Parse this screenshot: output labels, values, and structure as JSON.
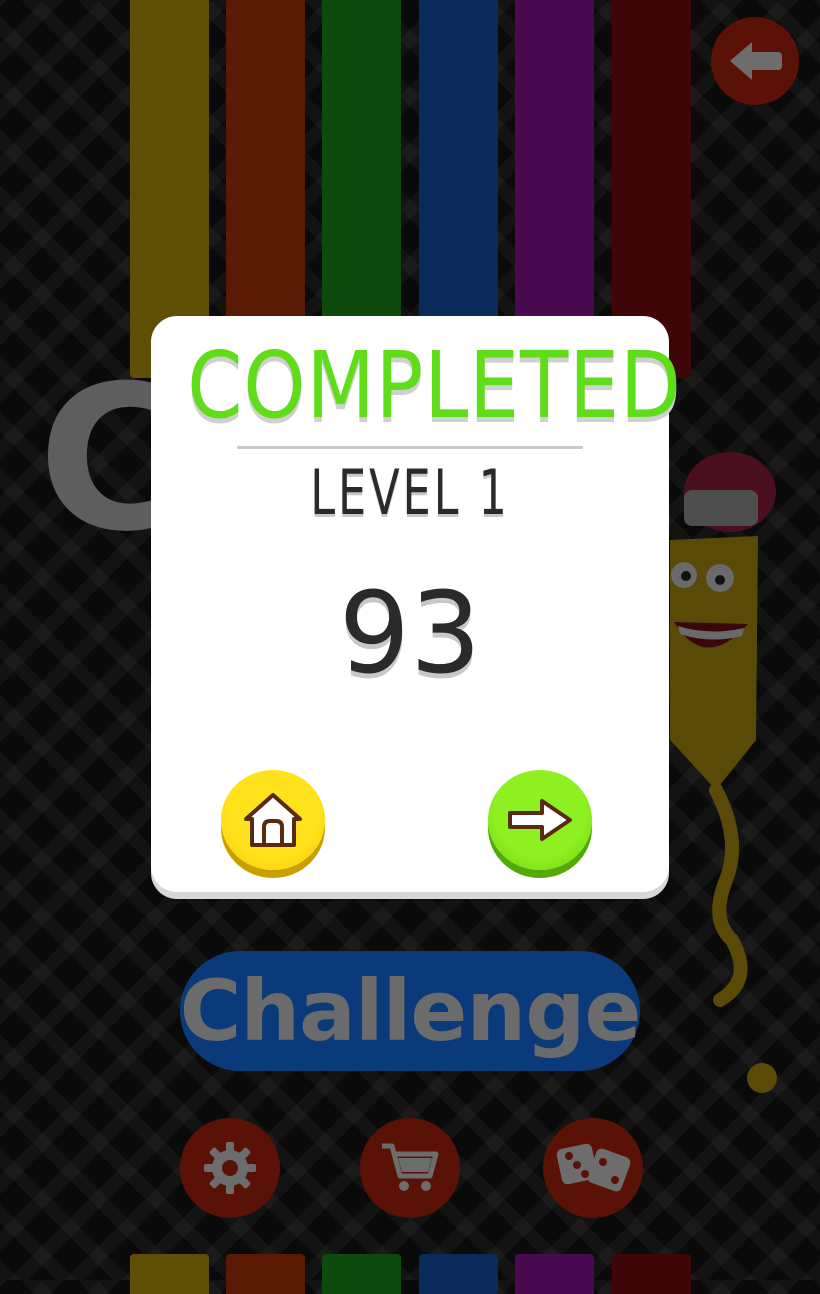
{
  "colors": {
    "stripes": [
      "#5e4e06",
      "#5a1a06",
      "#0e4a0e",
      "#0a2a5c",
      "#4a0a52",
      "#3e0606"
    ],
    "back_button": "#5a1206",
    "round_button": "#5a1206",
    "challenge_button": "#0b3a7a",
    "challenge_text": "#6b6b6b",
    "big_letter": "#5e5e5e",
    "completed_title": "#5fdd18",
    "level_text": "#2a2a2a",
    "score_text": "#2a2a2a",
    "divider": "#c9c9c9"
  },
  "background": {
    "big_letter": "C",
    "challenge_label": "Challenge",
    "icons": {
      "back": "back-arrow-icon",
      "settings": "gear-icon",
      "shop": "shopping-cart-icon",
      "random": "dice-icon"
    }
  },
  "dialog": {
    "title": "COMPLETED",
    "level": "LEVEL 1",
    "score": "93",
    "icons": {
      "home": "home-icon",
      "next": "right-arrow-icon"
    }
  }
}
